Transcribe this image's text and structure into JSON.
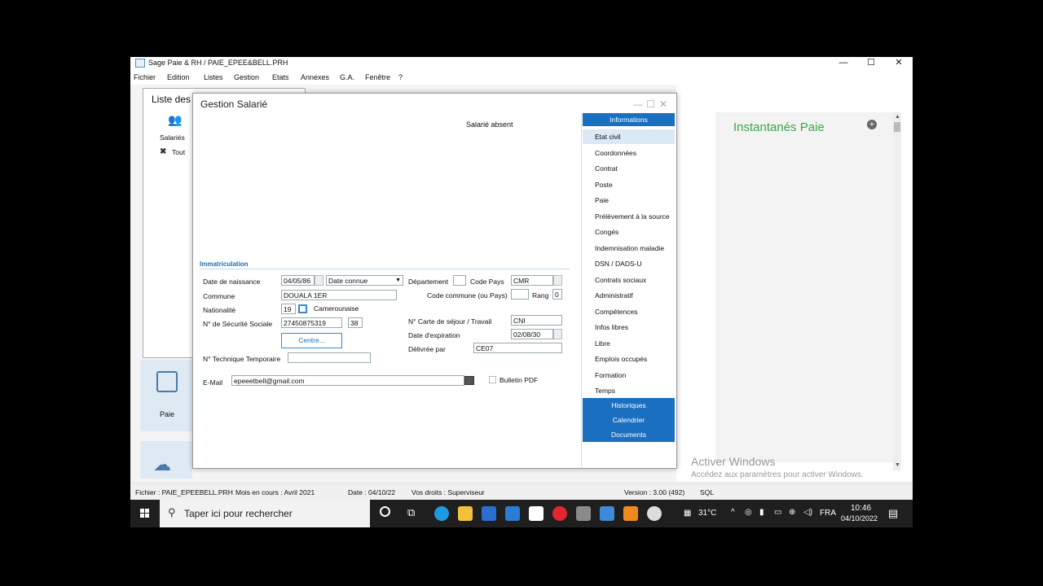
{
  "app": {
    "title": "Sage Paie & RH / PAIE_EPEE&BELL.PRH",
    "menu": [
      "Fichier",
      "Edition",
      "Listes",
      "Gestion",
      "Etats",
      "Annexes",
      "G.A.",
      "Fenêtre",
      "?"
    ]
  },
  "background": {
    "liste_title": "Liste des",
    "salaries_label": "Salariés",
    "tout_label": "Tout",
    "paie_tile_label": "Paie",
    "instantanes_title": "Instantanés Paie",
    "activate_title": "Activer Windows",
    "activate_sub": "Accédez aux paramètres pour activer Windows."
  },
  "dialog": {
    "title": "Gestion Salarié",
    "absent": "Salarié absent",
    "section": "Immatriculation",
    "labels": {
      "birth": "Date de naissance",
      "commune": "Commune",
      "nationalite": "Nationalité",
      "secu": "N° de Sécurité Sociale",
      "tech": "N° Technique Temporaire",
      "email": "E-Mail",
      "departement": "Département",
      "code_pays": "Code Pays",
      "code_commune": "Code commune (ou Pays)",
      "rang": "Rang",
      "carte": "N° Carte de séjour / Travail",
      "expiration": "Date d'expiration",
      "delivree": "Délivrée par",
      "bulletin": "Bulletin PDF"
    },
    "values": {
      "birth_date": "04/05/86",
      "birth_type": "Date connue",
      "commune": "DOUALA 1ER",
      "nat_code": "19",
      "nat_name": "Camerounaise",
      "secu": "27450875319",
      "secu_key": "38",
      "centre_button": "Centre...",
      "tech": "",
      "email": "epeeetbell@gmail.com",
      "departement": "",
      "code_pays": "CMR",
      "code_commune": "",
      "rang": "0",
      "carte": "CNI",
      "expiration": "02/08/30",
      "delivree": "CE07"
    }
  },
  "nav": {
    "header": "Informations",
    "items": [
      "Etat civil",
      "Coordonnées",
      "Contrat",
      "Poste",
      "Paie",
      "Prélèvement à la source",
      "Congés",
      "Indemnisation maladie",
      "DSN / DADS-U",
      "Contrats sociaux",
      "Administratif",
      "Compétences",
      "Infos libres",
      "Libre",
      "Emplois occupés",
      "Formation",
      "Temps"
    ],
    "blue_items": [
      "Historiques",
      "Calendrier",
      "Documents"
    ]
  },
  "status": {
    "fichier": "Fichier : PAIE_EPEEBELL.PRH",
    "mois": "Mois en cours : Avril 2021",
    "date": "Date : 04/10/22",
    "droits": "Vos droits : Superviseur",
    "version": "Version : 3.00 (492)",
    "sql": "SQL"
  },
  "taskbar": {
    "search_placeholder": "Taper ici pour rechercher",
    "temperature": "31°C",
    "lang": "FRA",
    "time": "10:46",
    "date": "04/10/2022"
  },
  "colors": {
    "accent": "#1a6fc0",
    "green": "#3aa843"
  }
}
